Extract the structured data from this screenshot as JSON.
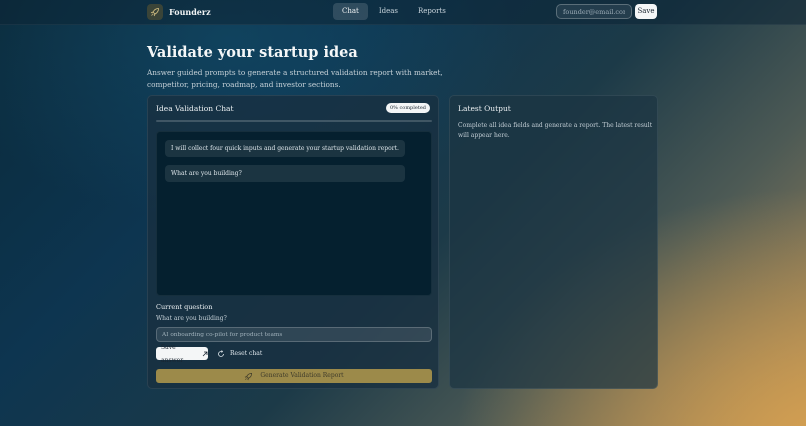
{
  "header": {
    "brand_name": "Founderz",
    "nav": [
      {
        "label": "Chat",
        "active": true
      },
      {
        "label": "Ideas",
        "active": false
      },
      {
        "label": "Reports",
        "active": false
      }
    ],
    "email_placeholder": "founder@email.com",
    "save_label": "Save"
  },
  "hero": {
    "title": "Validate your startup idea",
    "subtitle": "Answer guided prompts to generate a structured validation report with market, competitor, pricing, roadmap, and investor sections."
  },
  "chat_panel": {
    "title": "Idea Validation Chat",
    "progress_label": "0% completed",
    "progress_percent": 0,
    "messages": [
      "I will collect four quick inputs and generate your startup validation report.",
      "What are you building?"
    ],
    "current_question_label": "Current question",
    "current_question": "What are you building?",
    "answer_placeholder": "AI onboarding co-pilot for product teams",
    "save_answer_label": "Save answer",
    "reset_label": "Reset chat",
    "generate_label": "Generate Validation Report"
  },
  "output_panel": {
    "title": "Latest Output",
    "body": "Complete all idea fields and generate a report. The latest result will appear here."
  },
  "colors": {
    "accent_gold": "#9c8a4a",
    "progress_fill": "#e0c070"
  },
  "icons": {
    "brand": "rocket-icon",
    "save_answer": "arrow-up-right-icon",
    "reset": "refresh-icon",
    "generate": "rocket-icon"
  }
}
